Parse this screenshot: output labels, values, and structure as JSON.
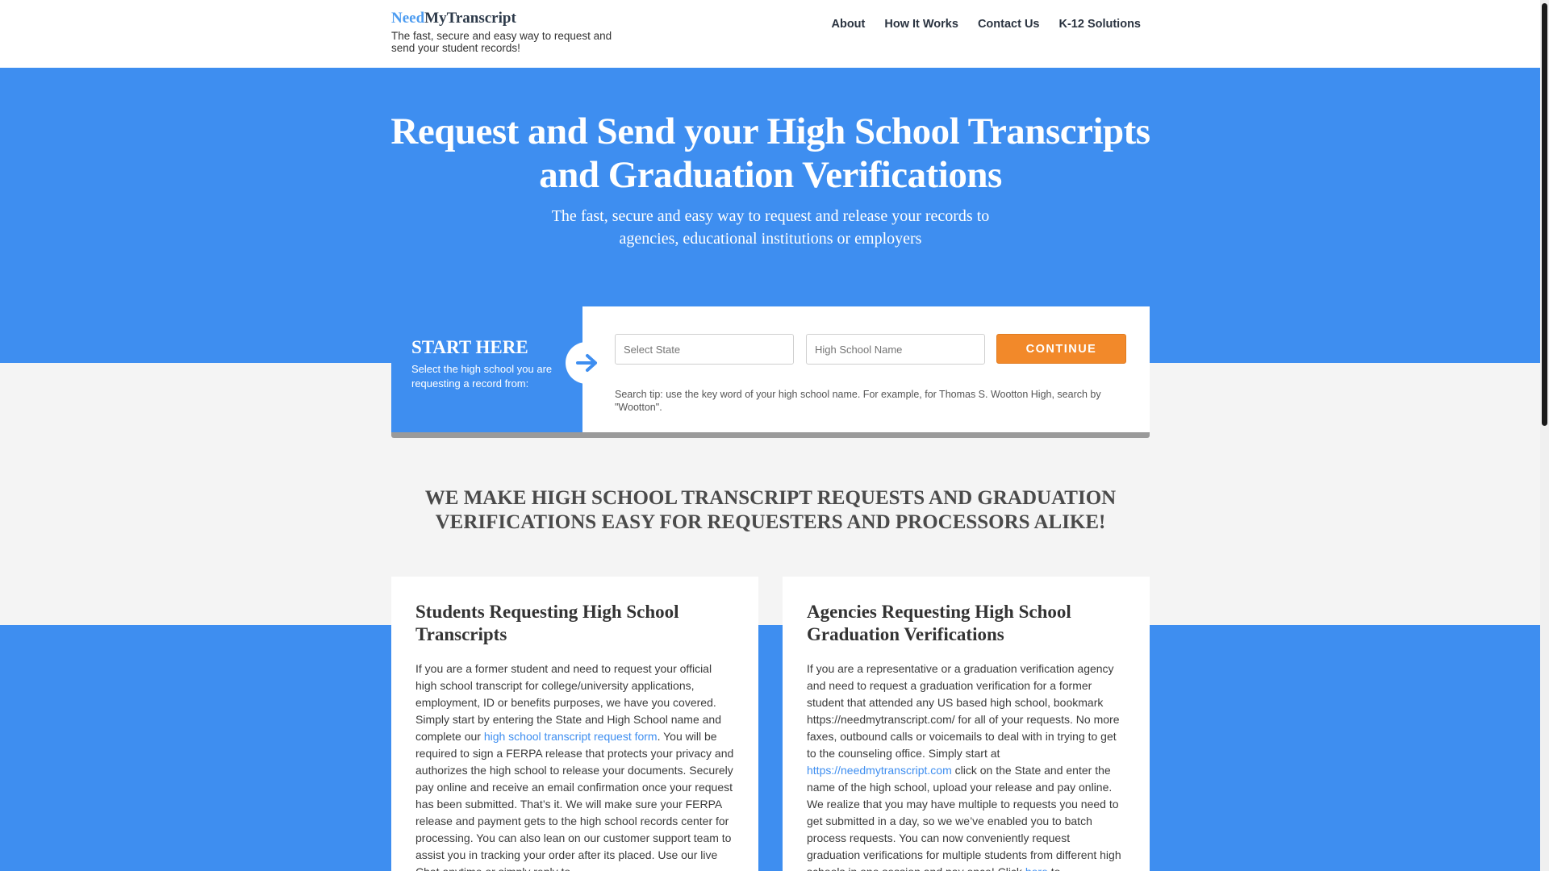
{
  "header": {
    "logo_part1": "Need",
    "logo_part2": "MyTranscript",
    "tagline": "The fast, secure and easy way to request and send your student records!",
    "nav": [
      "About",
      "How It Works",
      "Contact Us",
      "K-12 Solutions"
    ]
  },
  "hero": {
    "title": "Request and Send your High School Transcripts and Graduation Verifications",
    "subtitle": "The fast, secure and easy way to request and release your records to agencies, educational institutions or employers"
  },
  "start": {
    "title": "START HERE",
    "description": "Select the high school you are requesting a record from:",
    "state_placeholder": "Select State",
    "school_placeholder": "High School Name",
    "continue_label": "CONTINUE",
    "search_tip": "Search tip: use the key word of your high school name. For example, for Thomas S. Wootton High, search by \"Wootton\"."
  },
  "section": {
    "headline": "WE MAKE HIGH SCHOOL TRANSCRIPT REQUESTS AND GRADUATION VERIFICATIONS EASY FOR REQUESTERS AND PROCESSORS ALIKE!"
  },
  "cards": {
    "students": {
      "title": "Students Requesting High School Transcripts",
      "text_before_link": "If you are a former student and need to request your official high school transcript for college/university applications, employment, ID or benefits purposes, we have you covered. Simply start by entering the State and High School name and complete our ",
      "link_text": "high school transcript request form",
      "text_after_link": ". You will be required to sign a FERPA release that protects your privacy and authorizes the high school to release your documents. Securely pay online and receive an email confirmation once your request has been submitted. That’s it. We will make sure your FERPA release and payment gets to the high school records center for processing. You can also lean on our customer support team to assist you in tracking your order after its placed. Use our live Chat anytime or simply reply to"
    },
    "agencies": {
      "title": "Agencies Requesting High School Graduation Verifications",
      "text_before_link": "If you are a representative or a graduation verification agency and need to request a graduation verification for a former student that attended any US based high school, bookmark https://needmytranscript.com/ for all of your requests. No more faxes, outbound calls or voicemails to deal with in trying to get to the counseling office. Simply start at ",
      "link_text": "https://needmytranscript.com",
      "text_after_link": " click on the State and enter the name of the high school, upload your release and pay online. We realize that you may have multiple to requests you need to get submitted in a day, so we we’ve enabled you to batch process requests. You can now conveniently request graduation verifications for multiple students from different high schools in one session and pay once! Click ",
      "link2_text": "here",
      "text_end": " to"
    }
  },
  "colors": {
    "brand_blue": "#3e8ef0",
    "accent_orange": "#f2892a",
    "background": "#f4f4f4"
  },
  "icons": {
    "start_arrow": "arrow-right-icon"
  }
}
